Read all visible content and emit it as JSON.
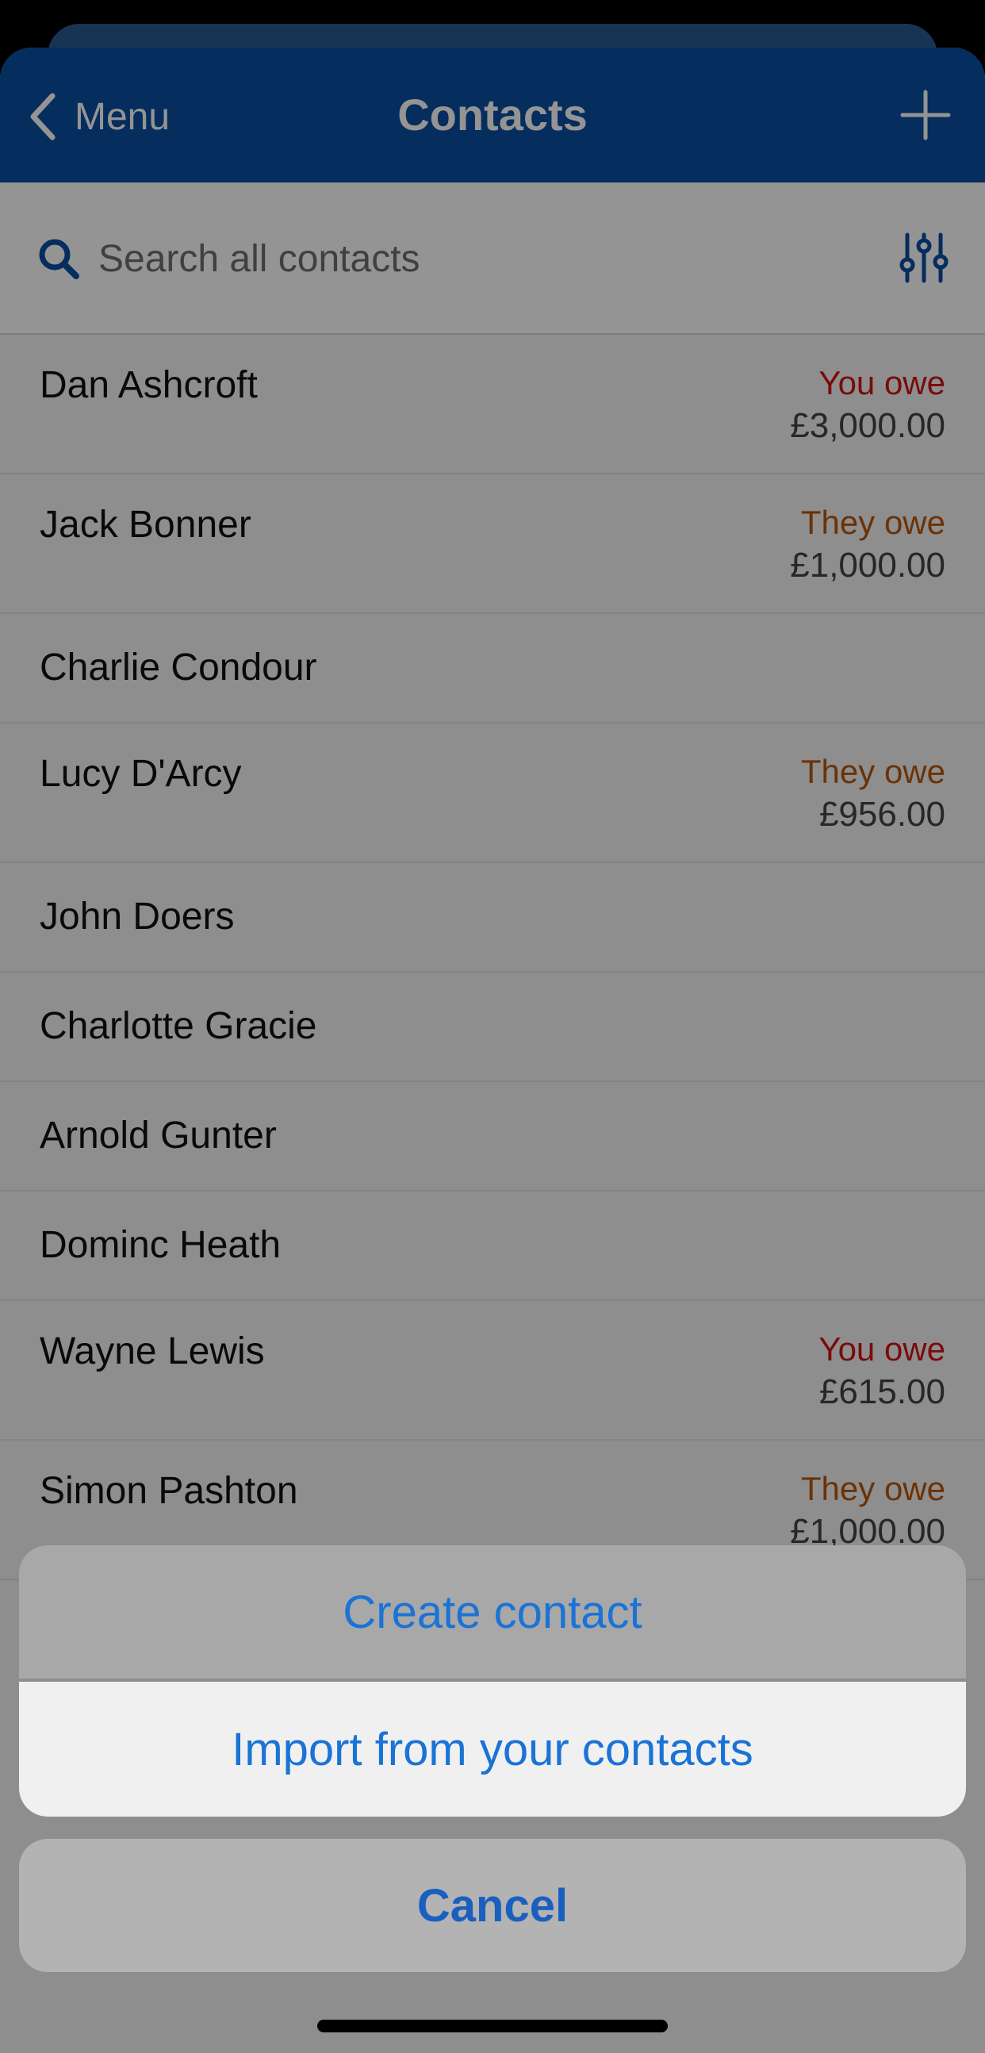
{
  "header": {
    "back_label": "Menu",
    "title": "Contacts",
    "add_icon": "plus-icon",
    "background_color": "#0a4fa0"
  },
  "search": {
    "placeholder": "Search all contacts",
    "value": "",
    "icon": "search-icon",
    "filter_icon": "sliders-icon"
  },
  "contacts": [
    {
      "name": "Dan Ashcroft",
      "status": "You owe",
      "amount": "£3,000.00"
    },
    {
      "name": "Jack Bonner",
      "status": "They owe",
      "amount": "£1,000.00"
    },
    {
      "name": "Charlie Condour",
      "status": "",
      "amount": ""
    },
    {
      "name": "Lucy D'Arcy",
      "status": "They owe",
      "amount": "£956.00"
    },
    {
      "name": "John Doers",
      "status": "",
      "amount": ""
    },
    {
      "name": "Charlotte Gracie",
      "status": "",
      "amount": ""
    },
    {
      "name": "Arnold Gunter",
      "status": "",
      "amount": ""
    },
    {
      "name": "Dominc Heath",
      "status": "",
      "amount": ""
    },
    {
      "name": "Wayne Lewis",
      "status": "You owe",
      "amount": "£615.00"
    },
    {
      "name": "Simon Pashton",
      "status": "They owe",
      "amount": "£1,000.00"
    }
  ],
  "action_sheet": {
    "create_label": "Create contact",
    "import_label": "Import from your contacts",
    "cancel_label": "Cancel"
  },
  "colors": {
    "you_owe": "#d01414",
    "they_owe": "#b8560c",
    "action_text": "#1a73d6"
  }
}
